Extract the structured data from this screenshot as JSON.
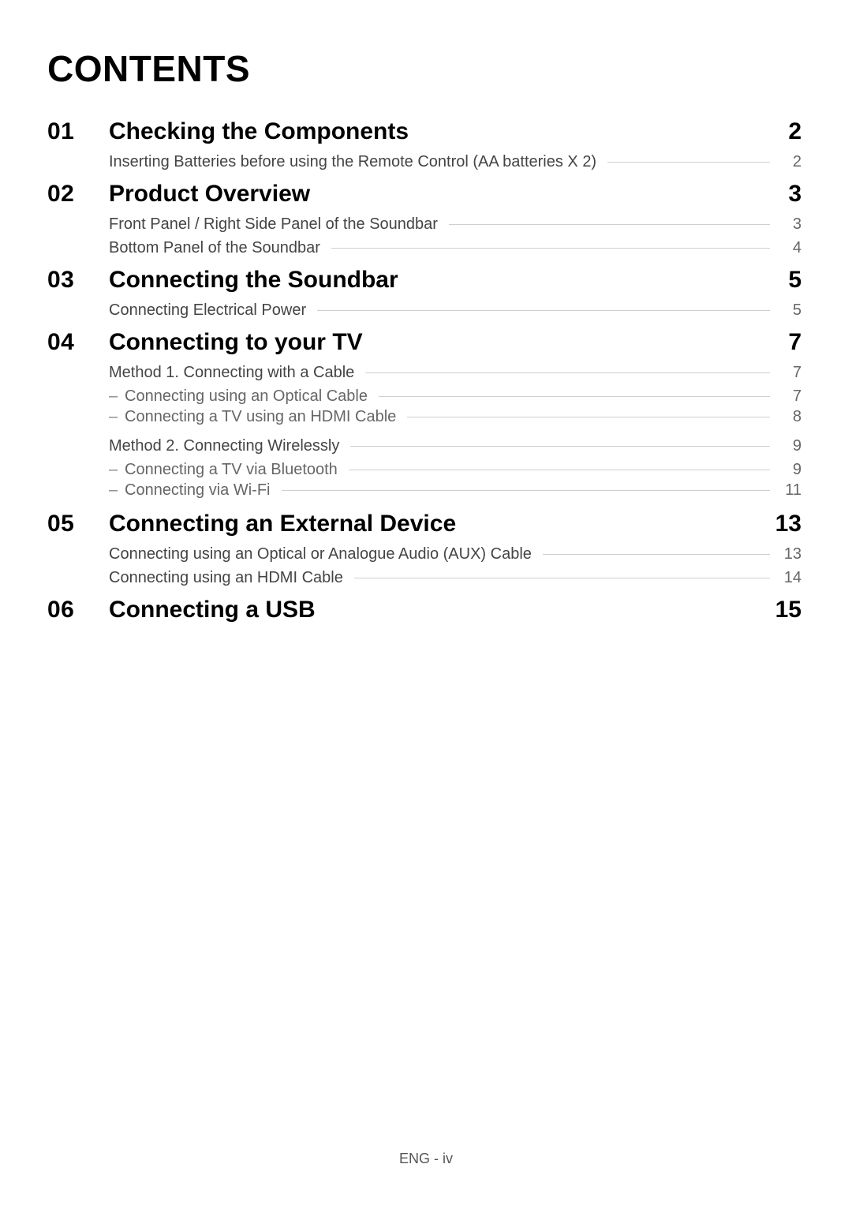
{
  "page_title": "CONTENTS",
  "footer": "ENG - iv",
  "toc": {
    "sections": [
      {
        "num": "01",
        "title": "Checking the Components",
        "page": "2",
        "subs": [
          {
            "label": "Inserting Batteries before using the Remote Control (AA batteries X 2)",
            "page": "2"
          }
        ]
      },
      {
        "num": "02",
        "title": "Product Overview",
        "page": "3",
        "subs": [
          {
            "label": "Front Panel / Right Side Panel of the Soundbar",
            "page": "3"
          },
          {
            "label": "Bottom Panel of the Soundbar",
            "page": "4"
          }
        ]
      },
      {
        "num": "03",
        "title": "Connecting the Soundbar",
        "page": "5",
        "subs": [
          {
            "label": "Connecting Electrical Power",
            "page": "5"
          }
        ]
      },
      {
        "num": "04",
        "title": "Connecting to your TV",
        "page": "7",
        "groups": [
          {
            "head": {
              "label": "Method 1. Connecting with a Cable",
              "page": "7"
            },
            "items": [
              {
                "label": "Connecting using an Optical Cable",
                "page": "7"
              },
              {
                "label": "Connecting a TV using an HDMI Cable",
                "page": "8"
              }
            ]
          },
          {
            "head": {
              "label": "Method 2. Connecting Wirelessly",
              "page": "9"
            },
            "items": [
              {
                "label": "Connecting a TV via Bluetooth",
                "page": "9"
              },
              {
                "label": "Connecting via Wi-Fi",
                "page": "11"
              }
            ]
          }
        ]
      },
      {
        "num": "05",
        "title": "Connecting an External Device",
        "page": "13",
        "subs": [
          {
            "label": "Connecting using an Optical or Analogue Audio (AUX) Cable",
            "page": "13"
          },
          {
            "label": "Connecting using an HDMI Cable",
            "page": "14"
          }
        ]
      },
      {
        "num": "06",
        "title": "Connecting a USB",
        "page": "15"
      }
    ]
  }
}
